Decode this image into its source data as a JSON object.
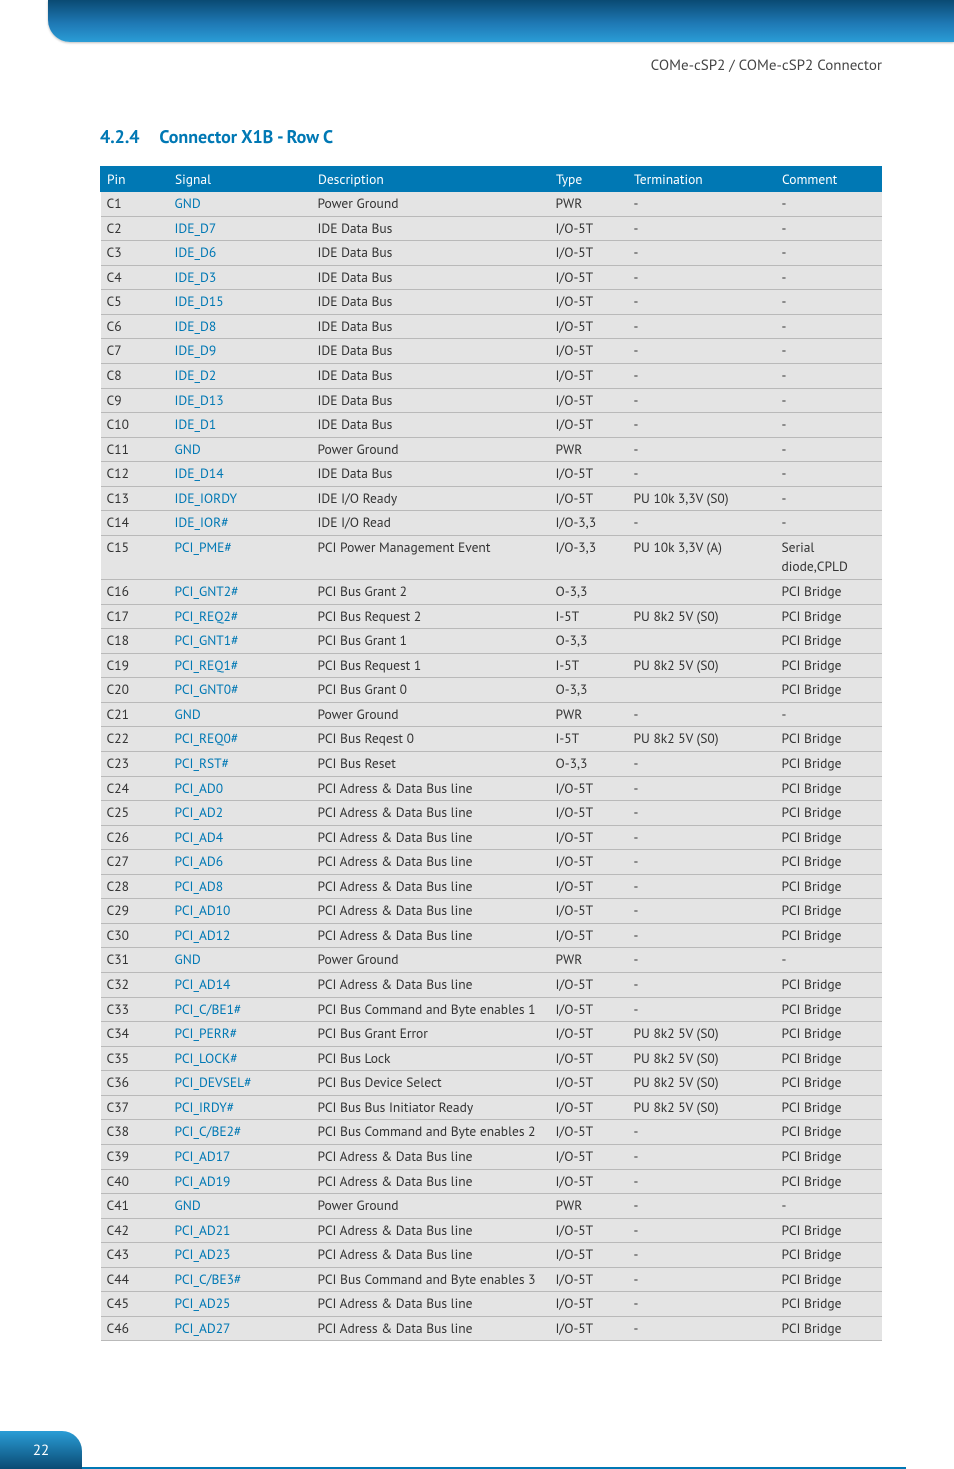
{
  "header": {
    "breadcrumb": "COMe-cSP2 / COMe-cSP2 Connector"
  },
  "section": {
    "number": "4.2.4",
    "title": "Connector X1B - Row C"
  },
  "table": {
    "headers": {
      "pin": "Pin",
      "signal": "Signal",
      "description": "Description",
      "type": "Type",
      "termination": "Termination",
      "comment": "Comment"
    },
    "rows": [
      {
        "pin": "C1",
        "signal": "GND",
        "description": "Power Ground",
        "type": "PWR",
        "termination": "-",
        "comment": "-"
      },
      {
        "pin": "C2",
        "signal": "IDE_D7",
        "description": "IDE Data Bus",
        "type": "I/O-5T",
        "termination": "-",
        "comment": "-"
      },
      {
        "pin": "C3",
        "signal": "IDE_D6",
        "description": "IDE Data Bus",
        "type": "I/O-5T",
        "termination": "-",
        "comment": "-"
      },
      {
        "pin": "C4",
        "signal": "IDE_D3",
        "description": "IDE Data Bus",
        "type": "I/O-5T",
        "termination": "-",
        "comment": "-"
      },
      {
        "pin": "C5",
        "signal": "IDE_D15",
        "description": "IDE Data Bus",
        "type": "I/O-5T",
        "termination": "-",
        "comment": "-"
      },
      {
        "pin": "C6",
        "signal": "IDE_D8",
        "description": "IDE Data Bus",
        "type": "I/O-5T",
        "termination": "-",
        "comment": "-"
      },
      {
        "pin": "C7",
        "signal": "IDE_D9",
        "description": "IDE Data Bus",
        "type": "I/O-5T",
        "termination": "-",
        "comment": "-"
      },
      {
        "pin": "C8",
        "signal": "IDE_D2",
        "description": "IDE Data Bus",
        "type": "I/O-5T",
        "termination": "-",
        "comment": "-"
      },
      {
        "pin": "C9",
        "signal": "IDE_D13",
        "description": "IDE Data Bus",
        "type": "I/O-5T",
        "termination": "-",
        "comment": "-"
      },
      {
        "pin": "C10",
        "signal": "IDE_D1",
        "description": "IDE Data Bus",
        "type": "I/O-5T",
        "termination": "-",
        "comment": "-"
      },
      {
        "pin": "C11",
        "signal": "GND",
        "description": "Power Ground",
        "type": "PWR",
        "termination": "-",
        "comment": "-"
      },
      {
        "pin": "C12",
        "signal": "IDE_D14",
        "description": "IDE Data Bus",
        "type": "I/O-5T",
        "termination": "-",
        "comment": "-"
      },
      {
        "pin": "C13",
        "signal": "IDE_IORDY",
        "description": "IDE I/O Ready",
        "type": "I/O-5T",
        "termination": "PU 10k  3,3V (S0)",
        "comment": "-"
      },
      {
        "pin": "C14",
        "signal": "IDE_IOR#",
        "description": "IDE I/O Read",
        "type": "I/O-3,3",
        "termination": "-",
        "comment": "-"
      },
      {
        "pin": "C15",
        "signal": "PCI_PME#",
        "description": "PCI Power Management Event",
        "type": "I/O-3,3",
        "termination": "PU 10k  3,3V (A)",
        "comment": "Serial diode,CPLD"
      },
      {
        "pin": "C16",
        "signal": "PCI_GNT2#",
        "description": "PCI Bus Grant 2",
        "type": "O-3,3",
        "termination": "",
        "comment": "PCI Bridge"
      },
      {
        "pin": "C17",
        "signal": "PCI_REQ2#",
        "description": "PCI Bus Request 2",
        "type": "I-5T",
        "termination": "PU 8k2  5V (S0)",
        "comment": "PCI Bridge"
      },
      {
        "pin": "C18",
        "signal": "PCI_GNT1#",
        "description": "PCI Bus Grant 1",
        "type": "O-3,3",
        "termination": "",
        "comment": "PCI Bridge"
      },
      {
        "pin": "C19",
        "signal": "PCI_REQ1#",
        "description": "PCI Bus Request 1",
        "type": "I-5T",
        "termination": "PU 8k2 5V (S0)",
        "comment": "PCI Bridge"
      },
      {
        "pin": "C20",
        "signal": "PCI_GNT0#",
        "description": "PCI Bus Grant 0",
        "type": "O-3,3",
        "termination": "",
        "comment": "PCI Bridge"
      },
      {
        "pin": "C21",
        "signal": "GND",
        "description": "Power Ground",
        "type": "PWR",
        "termination": "-",
        "comment": "-"
      },
      {
        "pin": "C22",
        "signal": "PCI_REQ0#",
        "description": "PCI Bus Reqest 0",
        "type": "I-5T",
        "termination": "PU 8k2 5V (S0)",
        "comment": "PCI Bridge"
      },
      {
        "pin": "C23",
        "signal": "PCI_RST#",
        "description": "PCI Bus Reset",
        "type": "O-3,3",
        "termination": "-",
        "comment": "PCI Bridge"
      },
      {
        "pin": "C24",
        "signal": "PCI_AD0",
        "description": "PCI Adress & Data Bus line",
        "type": "I/O-5T",
        "termination": "-",
        "comment": "PCI Bridge"
      },
      {
        "pin": "C25",
        "signal": "PCI_AD2",
        "description": "PCI Adress & Data Bus line",
        "type": "I/O-5T",
        "termination": "-",
        "comment": "PCI Bridge"
      },
      {
        "pin": "C26",
        "signal": "PCI_AD4",
        "description": "PCI Adress & Data Bus line",
        "type": "I/O-5T",
        "termination": "-",
        "comment": "PCI Bridge"
      },
      {
        "pin": "C27",
        "signal": "PCI_AD6",
        "description": "PCI Adress & Data Bus line",
        "type": "I/O-5T",
        "termination": "-",
        "comment": "PCI Bridge"
      },
      {
        "pin": "C28",
        "signal": "PCI_AD8",
        "description": "PCI Adress & Data Bus line",
        "type": "I/O-5T",
        "termination": "-",
        "comment": "PCI Bridge"
      },
      {
        "pin": "C29",
        "signal": "PCI_AD10",
        "description": "PCI Adress & Data Bus line",
        "type": "I/O-5T",
        "termination": "-",
        "comment": "PCI Bridge"
      },
      {
        "pin": "C30",
        "signal": "PCI_AD12",
        "description": "PCI Adress & Data Bus line",
        "type": "I/O-5T",
        "termination": "-",
        "comment": "PCI Bridge"
      },
      {
        "pin": "C31",
        "signal": "GND",
        "description": "Power Ground",
        "type": "PWR",
        "termination": "-",
        "comment": "-"
      },
      {
        "pin": "C32",
        "signal": "PCI_AD14",
        "description": "PCI Adress & Data Bus line",
        "type": "I/O-5T",
        "termination": "-",
        "comment": "PCI Bridge"
      },
      {
        "pin": "C33",
        "signal": "PCI_C/BE1#",
        "description": "PCI Bus Command and Byte enables 1",
        "type": "I/O-5T",
        "termination": "-",
        "comment": "PCI Bridge"
      },
      {
        "pin": "C34",
        "signal": "PCI_PERR#",
        "description": "PCI Bus Grant Error",
        "type": "I/O-5T",
        "termination": "PU 8k2 5V (S0)",
        "comment": "PCI Bridge"
      },
      {
        "pin": "C35",
        "signal": "PCI_LOCK#",
        "description": "PCI Bus Lock",
        "type": "I/O-5T",
        "termination": "PU 8k2 5V (S0)",
        "comment": "PCI Bridge"
      },
      {
        "pin": "C36",
        "signal": "PCI_DEVSEL#",
        "description": "PCI Bus Device Select",
        "type": "I/O-5T",
        "termination": "PU 8k2 5V (S0)",
        "comment": "PCI Bridge"
      },
      {
        "pin": "C37",
        "signal": "PCI_IRDY#",
        "description": "PCI Bus Bus Initiator Ready",
        "type": "I/O-5T",
        "termination": "PU 8k2 5V (S0)",
        "comment": "PCI Bridge"
      },
      {
        "pin": "C38",
        "signal": "PCI_C/BE2#",
        "description": "PCI Bus Command and Byte enables 2",
        "type": "I/O-5T",
        "termination": "-",
        "comment": "PCI Bridge"
      },
      {
        "pin": "C39",
        "signal": "PCI_AD17",
        "description": "PCI Adress & Data Bus line",
        "type": "I/O-5T",
        "termination": "-",
        "comment": "PCI Bridge"
      },
      {
        "pin": "C40",
        "signal": "PCI_AD19",
        "description": "PCI Adress & Data Bus line",
        "type": "I/O-5T",
        "termination": "-",
        "comment": "PCI Bridge"
      },
      {
        "pin": "C41",
        "signal": "GND",
        "description": "Power Ground",
        "type": "PWR",
        "termination": "-",
        "comment": "-"
      },
      {
        "pin": "C42",
        "signal": "PCI_AD21",
        "description": "PCI Adress & Data Bus line",
        "type": "I/O-5T",
        "termination": "-",
        "comment": "PCI Bridge"
      },
      {
        "pin": "C43",
        "signal": "PCI_AD23",
        "description": "PCI Adress & Data Bus line",
        "type": "I/O-5T",
        "termination": "-",
        "comment": "PCI Bridge"
      },
      {
        "pin": "C44",
        "signal": "PCI_C/BE3#",
        "description": "PCI Bus Command and Byte enables 3",
        "type": "I/O-5T",
        "termination": "-",
        "comment": "PCI Bridge"
      },
      {
        "pin": "C45",
        "signal": "PCI_AD25",
        "description": "PCI Adress & Data Bus line",
        "type": "I/O-5T",
        "termination": "-",
        "comment": "PCI Bridge"
      },
      {
        "pin": "C46",
        "signal": "PCI_AD27",
        "description": "PCI Adress & Data Bus line",
        "type": "I/O-5T",
        "termination": "-",
        "comment": "PCI Bridge"
      }
    ]
  },
  "footer": {
    "page": "22"
  }
}
